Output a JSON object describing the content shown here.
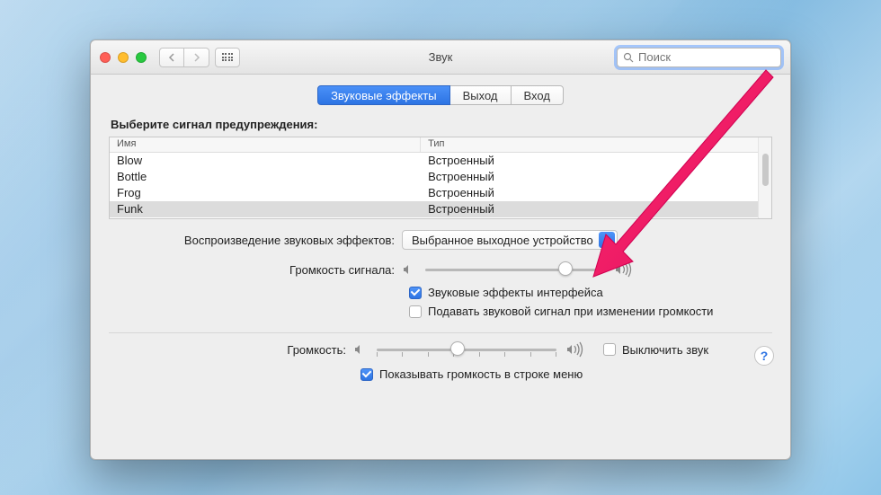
{
  "window": {
    "title": "Звук",
    "search_placeholder": "Поиск"
  },
  "tabs": {
    "effects": "Звуковые эффекты",
    "output": "Выход",
    "input": "Вход"
  },
  "section_label": "Выберите сигнал предупреждения:",
  "table": {
    "headers": {
      "name": "Имя",
      "type": "Тип"
    },
    "rows": [
      {
        "name": "Blow",
        "type": "Встроенный",
        "selected": false
      },
      {
        "name": "Bottle",
        "type": "Встроенный",
        "selected": false
      },
      {
        "name": "Frog",
        "type": "Встроенный",
        "selected": false
      },
      {
        "name": "Funk",
        "type": "Встроенный",
        "selected": true
      }
    ]
  },
  "playback": {
    "label": "Воспроизведение звуковых эффектов:",
    "value": "Выбранное выходное устройство"
  },
  "alert_volume": {
    "label": "Громкость сигнала:",
    "position_pct": 78
  },
  "checks": {
    "ui_sounds": "Звуковые эффекты интерфейса",
    "volume_change_feedback": "Подавать звуковой сигнал при изменении громкости"
  },
  "output_volume": {
    "label": "Громкость:",
    "position_pct": 45,
    "mute_label": "Выключить звук"
  },
  "menu_bar_check": "Показывать громкость в строке меню",
  "help_glyph": "?"
}
